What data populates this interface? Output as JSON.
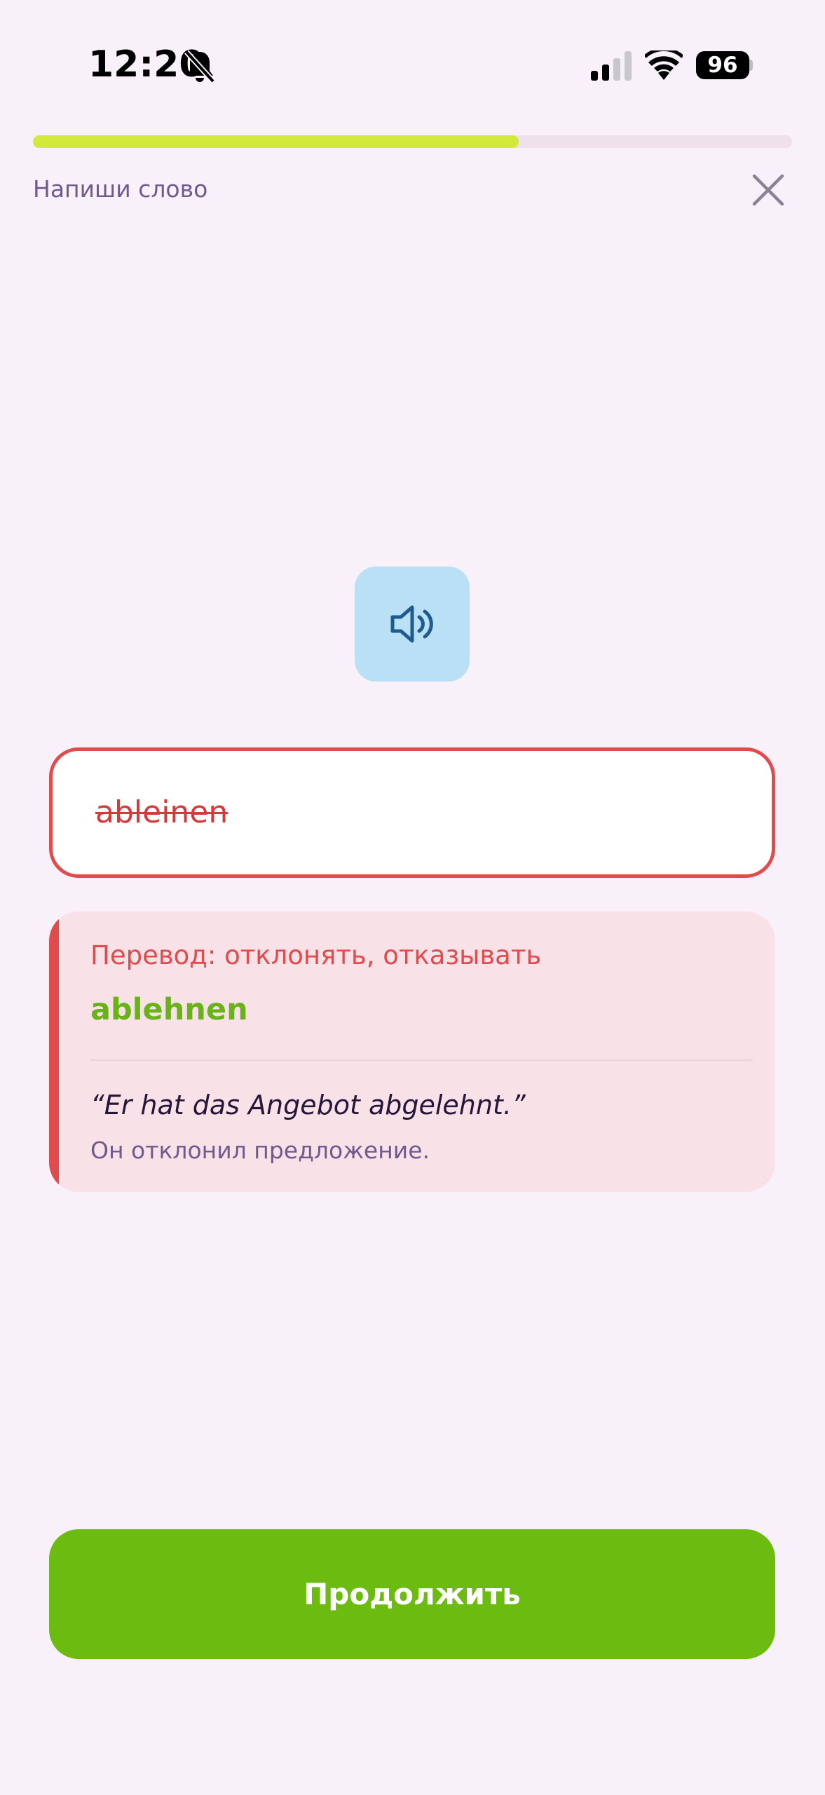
{
  "status_bar": {
    "time": "12:20",
    "battery": "96",
    "icons": [
      "bell-slash-icon",
      "signal-icon",
      "wifi-icon",
      "battery-icon"
    ]
  },
  "progress": {
    "fraction": 0.64,
    "fill_color": "#d3e93a"
  },
  "header": {
    "task_label": "Напиши слово",
    "close_icon": "close-icon"
  },
  "audio": {
    "icon": "speaker-icon"
  },
  "answer": {
    "value": "ableinen",
    "state": "incorrect"
  },
  "feedback": {
    "translation": "Перевод: отклонять, отказывать",
    "correct_word": "ablehnen",
    "example": "“Er hat das Angebot abgelehnt.”",
    "example_translation": "Он отклонил предложение."
  },
  "footer": {
    "continue_label": "Продолжить"
  },
  "colors": {
    "background": "#f9f1f9",
    "error": "#e04b4b",
    "success": "#6cbb10",
    "progress": "#d3e93a"
  }
}
